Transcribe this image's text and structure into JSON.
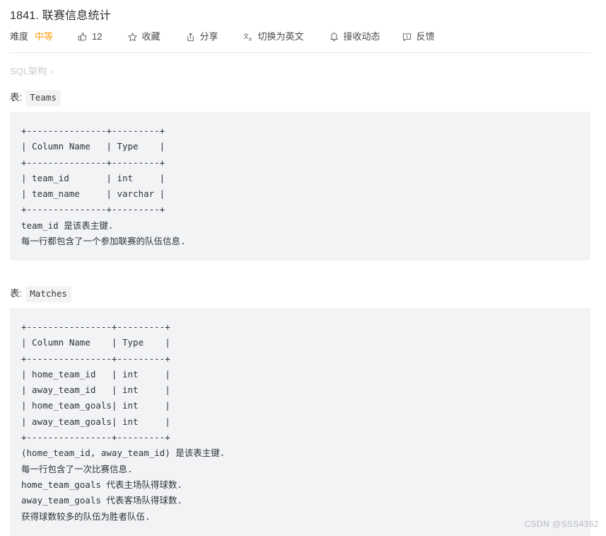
{
  "header": {
    "title": "1841. 联赛信息统计",
    "difficulty_label": "难度",
    "difficulty_value": "中等",
    "difficulty_color": "#ffa116",
    "likes_count": "12",
    "favorite_label": "收藏",
    "share_label": "分享",
    "translate_label": "切换为英文",
    "subscribe_label": "接收动态",
    "feedback_label": "反馈",
    "icons": {
      "thumbs_up": "thumbs-up-icon",
      "star": "star-icon",
      "share": "share-icon",
      "translate": "translate-icon",
      "bell": "bell-icon",
      "feedback": "feedback-icon"
    }
  },
  "breadcrumb": {
    "label": "SQL架构",
    "separator": "›"
  },
  "tables": {
    "teams": {
      "prefix": "表:",
      "name": "Teams",
      "code": "+---------------+---------+\n| Column Name   | Type    |\n+---------------+---------+\n| team_id       | int     |\n| team_name     | varchar |\n+---------------+---------+\nteam_id 是该表主键.\n每一行都包含了一个参加联赛的队伍信息."
    },
    "matches": {
      "prefix": "表:",
      "name": "Matches",
      "code": "+----------------+---------+\n| Column Name    | Type    |\n+----------------+---------+\n| home_team_id   | int     |\n| away_team_id   | int     |\n| home_team_goals| int     |\n| away_team_goals| int     |\n+----------------+---------+\n(home_team_id, away_team_id) 是该表主键.\n每一行包含了一次比赛信息.\nhome_team_goals 代表主场队得球数.\naway_team_goals 代表客场队得球数.\n获得球数较多的队伍为胜者队伍."
    }
  },
  "watermark": {
    "text": "CSDN @SSS4362"
  }
}
